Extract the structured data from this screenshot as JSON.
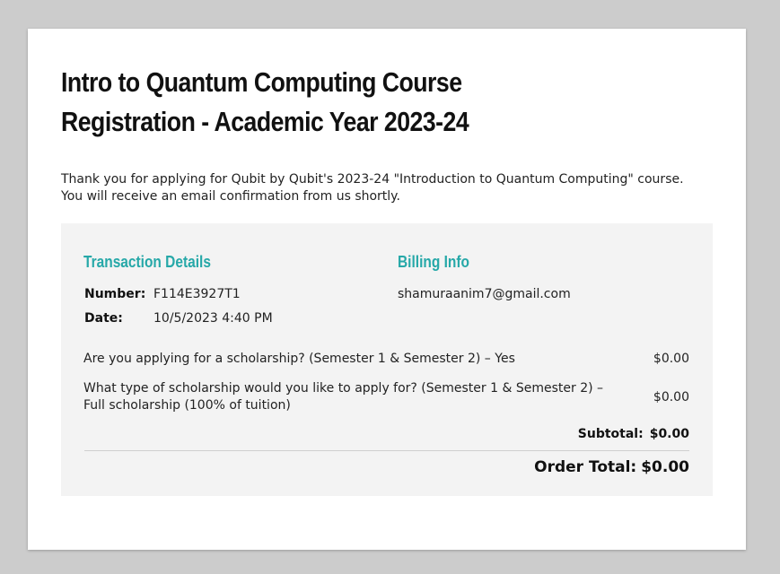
{
  "title": "Intro to Quantum Computing Course Registration - Academic Year 2023-24",
  "intro": "Thank you for applying for Qubit by Qubit's 2023-24 \"Introduction to Quantum Computing\" course. You will receive an email confirmation from us shortly.",
  "transaction": {
    "heading": "Transaction Details",
    "number_label": "Number:",
    "number_value": "F114E3927T1",
    "date_label": "Date:",
    "date_value": "10/5/2023 4:40 PM"
  },
  "billing": {
    "heading": "Billing Info",
    "email": "shamuraanim7@gmail.com"
  },
  "line_items": [
    {
      "description": "Are you applying for a scholarship? (Semester 1 & Semester 2)  – Yes",
      "price": "$0.00"
    },
    {
      "description": "What type of scholarship would you like to apply for? (Semester 1 & Semester 2)  – Full scholarship (100% of tuition)",
      "price": "$0.00"
    }
  ],
  "subtotal": {
    "label": "Subtotal:",
    "value": "$0.00"
  },
  "order_total": {
    "label": "Order Total:",
    "value": "$0.00"
  },
  "colors": {
    "page_background": "#cccccc",
    "card_background": "#ffffff",
    "panel_background": "#f3f3f3",
    "accent_heading": "#26a8a8"
  }
}
